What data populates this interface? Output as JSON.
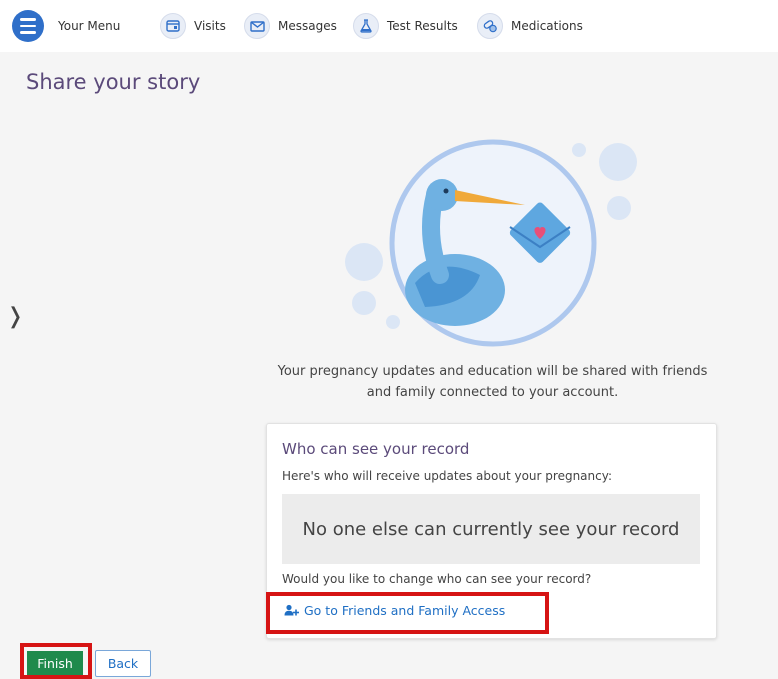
{
  "nav": {
    "menu_label": "Your Menu",
    "items": [
      {
        "label": "Visits",
        "icon": "calendar-icon"
      },
      {
        "label": "Messages",
        "icon": "envelope-icon"
      },
      {
        "label": "Test Results",
        "icon": "flask-icon"
      },
      {
        "label": "Medications",
        "icon": "pill-icon"
      }
    ]
  },
  "page": {
    "title": "Share your story",
    "description": "Your pregnancy updates and education will be shared with friends and family connected to your account."
  },
  "card": {
    "title": "Who can see your record",
    "subtitle": "Here's who will receive updates about your pregnancy:",
    "empty_message": "No one else can currently see your record",
    "question": "Would you like to change who can see your record?",
    "link_label": "Go to Friends and Family Access"
  },
  "buttons": {
    "finish": "Finish",
    "back": "Back"
  },
  "colors": {
    "accent": "#2f6fc9",
    "finish_green": "#1f8a4c",
    "highlight_red": "#d61414",
    "title_purple": "#5b4a7a",
    "link_blue": "#1f6fc4"
  }
}
